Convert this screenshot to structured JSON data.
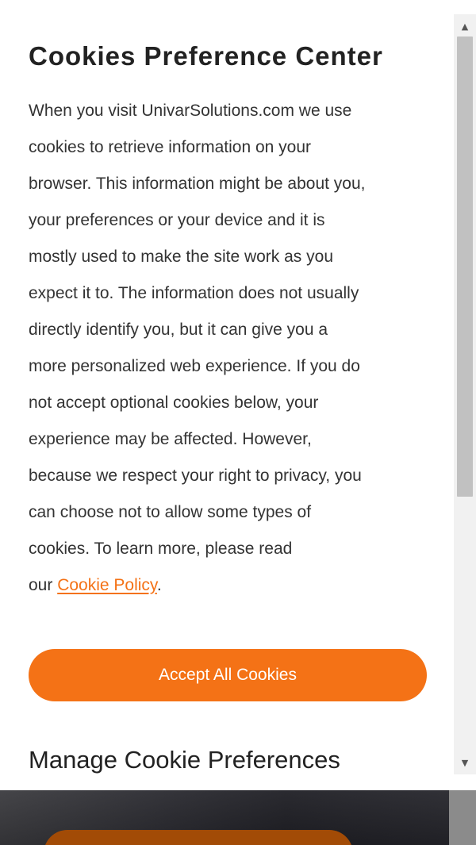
{
  "modal": {
    "title": "Cookies Preference Center",
    "description_lines": [
      "When you visit UnivarSolutions.com we use",
      "cookies to retrieve information on your",
      "browser. This information might be about you,",
      "your preferences or your device and it is",
      "mostly used to make the site work as you",
      "expect it to. The information does not usually",
      "directly identify you, but it can give you a",
      "more personalized web experience. If you do",
      "not accept optional cookies below, your",
      "experience may be affected. However,",
      "because we respect your right to privacy, you",
      "can choose not to allow some types of",
      "cookies. To learn more, please read"
    ],
    "last_line_prefix": "our ",
    "cookie_policy_link": "Cookie Policy",
    "last_line_suffix": ".",
    "accept_button_label": "Accept All Cookies",
    "manage_heading": "Manage Cookie Preferences"
  },
  "scrollbar": {
    "up_arrow": "▲",
    "down_arrow": "▼"
  },
  "colors": {
    "accent": "#f47216",
    "text": "#333333",
    "heading": "#222222"
  }
}
